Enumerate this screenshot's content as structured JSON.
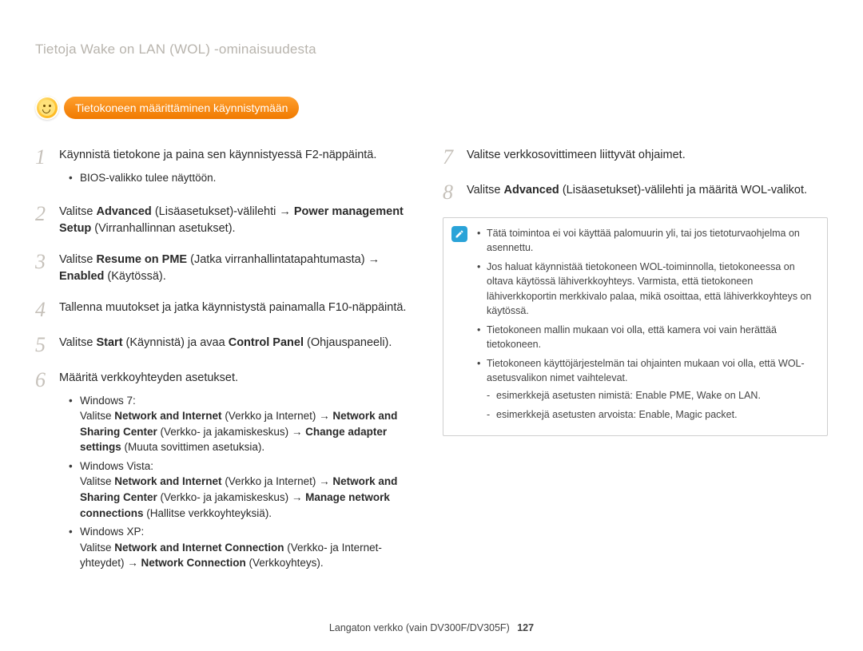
{
  "page_title": "Tietoja Wake on LAN (WOL) -ominaisuudesta",
  "badge": {
    "label": "Tietokoneen määrittäminen käynnistymään"
  },
  "left_steps": [
    {
      "num": "1",
      "html": "Käynnistä tietokone ja paina sen käynnistyessä F2-näppäintä.",
      "sub": [
        "BIOS-valikko tulee näyttöön."
      ]
    },
    {
      "num": "2",
      "html": "Valitse <b>Advanced</b> (Lisäasetukset)-välilehti → <b>Power management Setup</b> (Virranhallinnan asetukset)."
    },
    {
      "num": "3",
      "html": "Valitse <b>Resume on PME</b> (Jatka virranhallintatapahtumasta) → <b>Enabled</b> (Käytössä)."
    },
    {
      "num": "4",
      "html": "Tallenna muutokset ja jatka käynnistystä painamalla F10-näppäintä."
    },
    {
      "num": "5",
      "html": "Valitse <b>Start</b> (Käynnistä) ja avaa <b>Control Panel</b> (Ohjauspaneeli)."
    },
    {
      "num": "6",
      "html": "Määritä verkkoyhteyden asetukset.",
      "sub_rich": [
        "Windows 7:<br>Valitse <b>Network and Internet</b> (Verkko ja Internet) → <b>Network and Sharing Center</b> (Verkko- ja jakamiskeskus) → <b>Change adapter settings</b> (Muuta sovittimen asetuksia).",
        "Windows Vista:<br>Valitse <b>Network and Internet</b> (Verkko ja Internet) → <b>Network and Sharing Center</b> (Verkko- ja jakamiskeskus) → <b>Manage network connections</b> (Hallitse verkkoyhteyksiä).",
        "Windows XP:<br>Valitse <b>Network and Internet Connection</b> (Verkko- ja Internet-yhteydet) → <b>Network Connection</b> (Verkkoyhteys)."
      ]
    }
  ],
  "right_steps": [
    {
      "num": "7",
      "html": "Valitse verkkosovittimeen liittyvät ohjaimet."
    },
    {
      "num": "8",
      "html": "Valitse <b>Advanced</b> (Lisäasetukset)-välilehti ja määritä WOL-valikot."
    }
  ],
  "note_items": [
    "Tätä toimintoa ei voi käyttää palomuurin yli, tai jos tietoturvaohjelma on asennettu.",
    "Jos haluat käynnistää tietokoneen WOL-toiminnolla, tietokoneessa on oltava käytössä lähiverkkoyhteys. Varmista, että tietokoneen lähiverkkoportin merkkivalo palaa, mikä osoittaa, että lähiverkkoyhteys on käytössä.",
    "Tietokoneen mallin mukaan voi olla, että kamera voi vain herättää tietokoneen.",
    "Tietokoneen käyttöjärjestelmän tai ohjainten mukaan voi olla, että WOL-asetusvalikon nimet vaihtelevat."
  ],
  "note_sub": [
    "esimerkkejä asetusten nimistä: Enable PME, Wake on LAN.",
    "esimerkkejä asetusten arvoista: Enable, Magic packet."
  ],
  "footer": {
    "text": "Langaton verkko (vain DV300F/DV305F)",
    "page": "127"
  }
}
